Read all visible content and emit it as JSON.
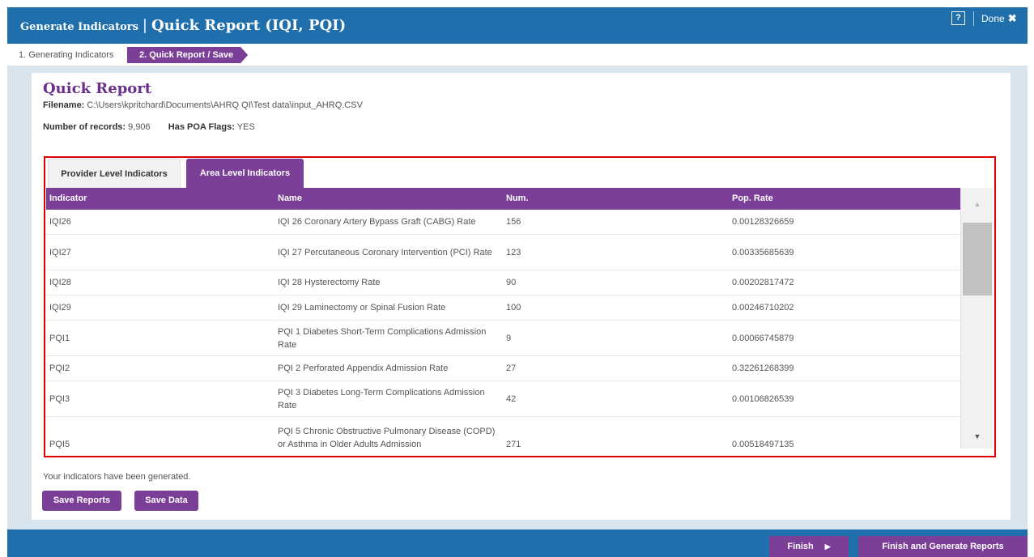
{
  "titlebar": {
    "small_title": "Generate Indicators",
    "separator": "|",
    "big_title": "Quick Report (IQI, PQI)",
    "help_label": "?",
    "done_label": "Done",
    "done_icon": "✖"
  },
  "steps": {
    "step1": "1. Generating Indicators",
    "step2": "2. Quick Report / Save"
  },
  "report": {
    "title": "Quick Report",
    "filename_label": "Filename:",
    "filename_value": "C:\\Users\\kpritchard\\Documents\\AHRQ QI\\Test data\\input_AHRQ.CSV",
    "records_label": "Number of records:",
    "records_value": "9,906",
    "poa_label": "Has POA Flags:",
    "poa_value": "YES"
  },
  "tabs": {
    "provider": "Provider Level Indicators",
    "area": "Area Level Indicators",
    "active": "area"
  },
  "grid": {
    "headers": [
      "Indicator",
      "Name",
      "Num.",
      "Pop. Rate"
    ],
    "rows": [
      {
        "indicator": "IQI26",
        "name": "IQI 26 Coronary Artery Bypass Graft (CABG) Rate",
        "num": "156",
        "rate": "0.00128326659"
      },
      {
        "indicator": "IQI27",
        "name": "IQI 27 Percutaneous Coronary Intervention (PCI) Rate",
        "num": "123",
        "rate": "0.00335685639"
      },
      {
        "indicator": "IQI28",
        "name": "IQI 28 Hysterectomy Rate",
        "num": "90",
        "rate": "0.00202817472"
      },
      {
        "indicator": "IQI29",
        "name": "IQI 29 Laminectomy or Spinal Fusion Rate",
        "num": "100",
        "rate": "0.00246710202"
      },
      {
        "indicator": "PQI1",
        "name": "PQI 1 Diabetes Short-Term Complications Admission Rate",
        "num": "9",
        "rate": "0.00066745879"
      },
      {
        "indicator": "PQI2",
        "name": "PQI 2 Perforated Appendix Admission Rate",
        "num": "27",
        "rate": "0.32261268399"
      },
      {
        "indicator": "PQI3",
        "name": "PQI 3 Diabetes Long-Term Complications Admission Rate",
        "num": "42",
        "rate": "0.00106826539"
      },
      {
        "indicator": "PQI5",
        "name": "PQI 5 Chronic Obstructive Pulmonary Disease (COPD) or Asthma in Older Adults Admission",
        "num": "271",
        "rate": "0.00518497135"
      }
    ]
  },
  "status_text": "Your indicators have been generated.",
  "buttons": {
    "save_reports": "Save Reports",
    "save_data": "Save Data",
    "finish": "Finish",
    "finish_generate": "Finish and Generate Reports"
  },
  "icons": {
    "scroll_up": "scroll-up-icon",
    "scroll_down": "scroll-down-icon",
    "finish_arrow": "arrow-right-icon",
    "close": "close-icon"
  },
  "colors": {
    "header_blue": "#1f6fad",
    "accent_purple": "#7b3f98",
    "content_bg": "#d9e5ee",
    "highlight_red": "#e00000"
  }
}
